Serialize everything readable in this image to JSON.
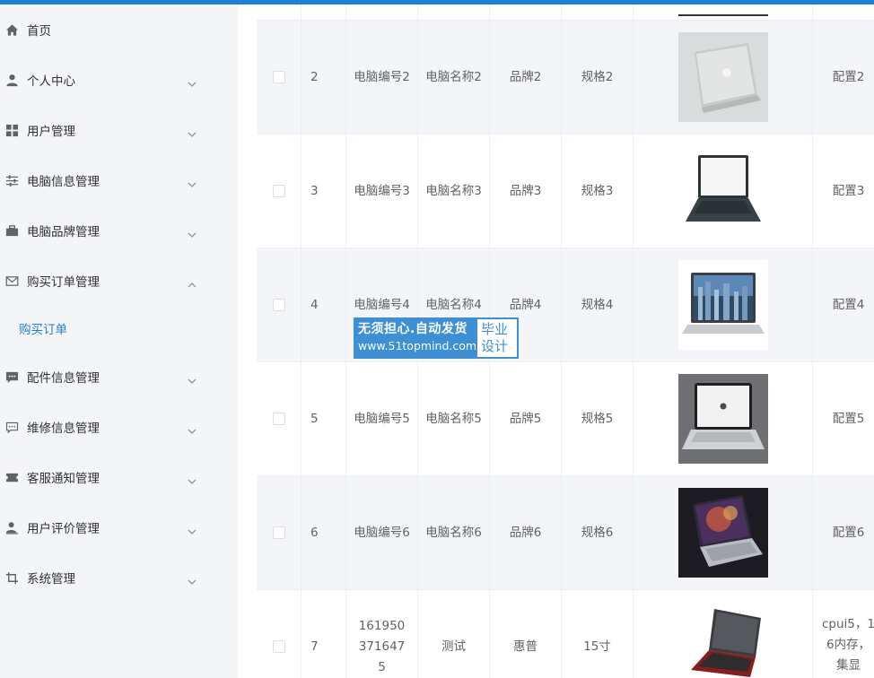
{
  "sidebar": {
    "items": [
      {
        "label": "首页",
        "icon": "home-icon",
        "arrow": "none"
      },
      {
        "label": "个人中心",
        "icon": "user-icon",
        "arrow": "down"
      },
      {
        "label": "用户管理",
        "icon": "grid-icon",
        "arrow": "down"
      },
      {
        "label": "电脑信息管理",
        "icon": "sliders-icon",
        "arrow": "down"
      },
      {
        "label": "电脑品牌管理",
        "icon": "briefcase-icon",
        "arrow": "down"
      },
      {
        "label": "购买订单管理",
        "icon": "mail-icon",
        "arrow": "up"
      },
      {
        "label": "配件信息管理",
        "icon": "chat-icon",
        "arrow": "down"
      },
      {
        "label": "维修信息管理",
        "icon": "chat-dots-icon",
        "arrow": "down"
      },
      {
        "label": "客服通知管理",
        "icon": "ticket-icon",
        "arrow": "down"
      },
      {
        "label": "用户评价管理",
        "icon": "user-edit-icon",
        "arrow": "down"
      },
      {
        "label": "系统管理",
        "icon": "crop-icon",
        "arrow": "down"
      }
    ],
    "active_submenu": "购买订单"
  },
  "table": {
    "rows": [
      {
        "index": "2",
        "code": "电脑编号2",
        "name": "电脑名称2",
        "brand": "品牌2",
        "spec": "规格2",
        "config": "配置2",
        "image": "laptop-silver-icon"
      },
      {
        "index": "3",
        "code": "电脑编号3",
        "name": "电脑名称3",
        "brand": "品牌3",
        "spec": "规格3",
        "config": "配置3",
        "image": "laptop-dark-icon"
      },
      {
        "index": "4",
        "code": "电脑编号4",
        "name": "电脑名称4",
        "brand": "品牌4",
        "spec": "规格4",
        "config": "配置4",
        "image": "laptop-city-icon"
      },
      {
        "index": "5",
        "code": "电脑编号5",
        "name": "电脑名称5",
        "brand": "品牌5",
        "spec": "规格5",
        "config": "配置5",
        "image": "laptop-apple-icon"
      },
      {
        "index": "6",
        "code": "电脑编号6",
        "name": "电脑名称6",
        "brand": "品牌6",
        "spec": "规格6",
        "config": "配置6",
        "image": "laptop-galaxy-icon"
      },
      {
        "index": "7",
        "code": "1619503716475",
        "name": "测试",
        "brand": "惠普",
        "spec": "15寸",
        "config": "cpui5，16内存，集显",
        "image": "laptop-red-icon"
      }
    ]
  },
  "watermark": {
    "line1": "无须担心.自动发货",
    "line2": "www.51topmind.com",
    "side": "毕业设计"
  },
  "colors": {
    "accent": "#1e7fd8",
    "sidebar_bg": "#f4f5f7",
    "row_alt_bg": "#f4f5f8",
    "watermark": "#3d8fd6"
  }
}
